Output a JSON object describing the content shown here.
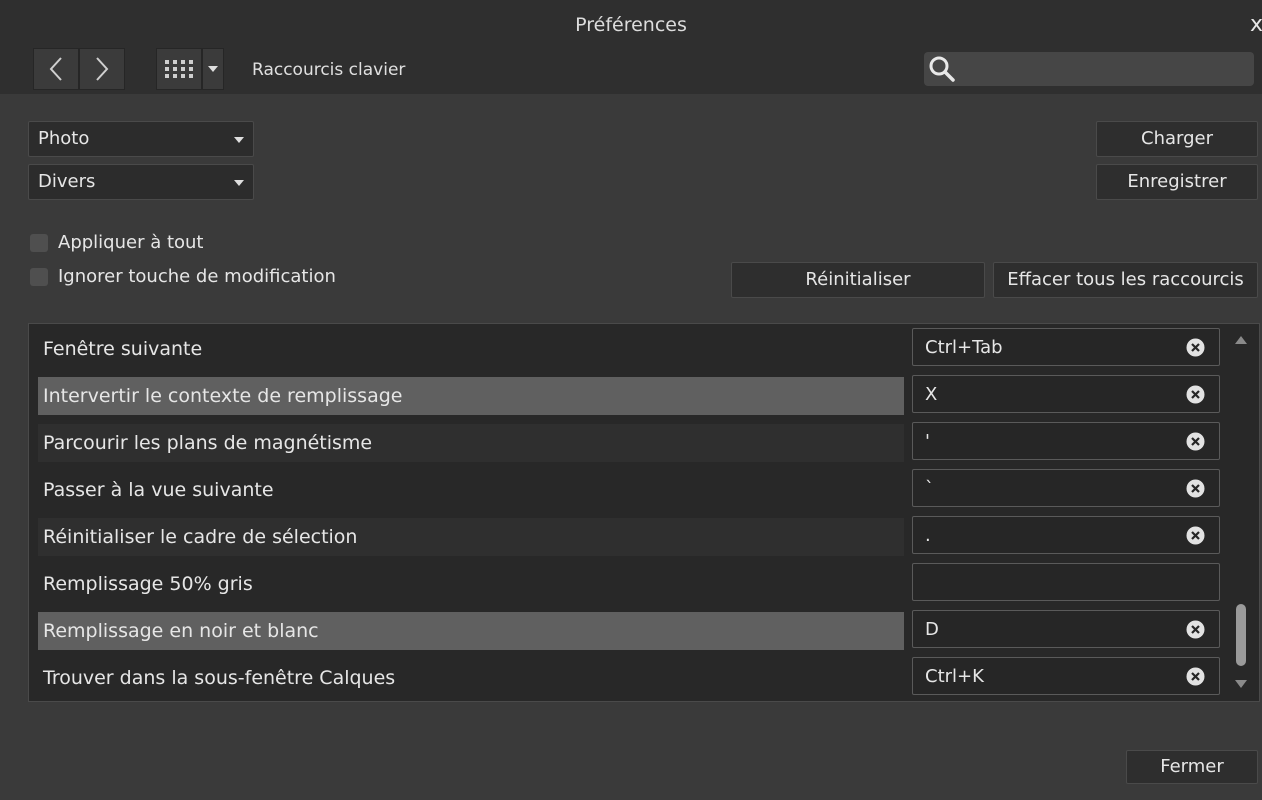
{
  "window": {
    "title": "Préférences",
    "close_glyph": "x"
  },
  "toolbar": {
    "back_icon": "chevron-left-icon",
    "forward_icon": "chevron-right-icon",
    "grid_icon": "grid-icon",
    "section_label": "Raccourcis clavier",
    "search_placeholder": "",
    "search_icon": "search-icon"
  },
  "filters": {
    "category_dropdown": "Photo",
    "subcategory_dropdown": "Divers"
  },
  "actions": {
    "load_label": "Charger",
    "save_label": "Enregistrer",
    "reset_label": "Réinitialiser",
    "clear_all_label": "Effacer tous les raccourcis",
    "close_label": "Fermer"
  },
  "options": {
    "apply_all_label": "Appliquer à tout",
    "apply_all_checked": false,
    "ignore_modifier_label": "Ignorer touche de modification",
    "ignore_modifier_checked": false
  },
  "shortcuts": [
    {
      "label": "Fenêtre suivante",
      "shortcut": "Ctrl+Tab",
      "highlighted": false
    },
    {
      "label": "Intervertir le contexte de remplissage",
      "shortcut": "X",
      "highlighted": true
    },
    {
      "label": "Parcourir les plans de magnétisme",
      "shortcut": "'",
      "highlighted": false
    },
    {
      "label": "Passer à la vue suivante",
      "shortcut": "`",
      "highlighted": false
    },
    {
      "label": "Réinitialiser le cadre de sélection",
      "shortcut": ".",
      "highlighted": false
    },
    {
      "label": "Remplissage 50% gris",
      "shortcut": "",
      "highlighted": false
    },
    {
      "label": "Remplissage en noir et blanc",
      "shortcut": "D",
      "highlighted": true
    },
    {
      "label": "Trouver dans la sous-fenêtre Calques",
      "shortcut": "Ctrl+K",
      "highlighted": false
    }
  ],
  "colors": {
    "background": "#3a3a3a",
    "highlight_row": "#606060",
    "field_bg": "#262626"
  }
}
